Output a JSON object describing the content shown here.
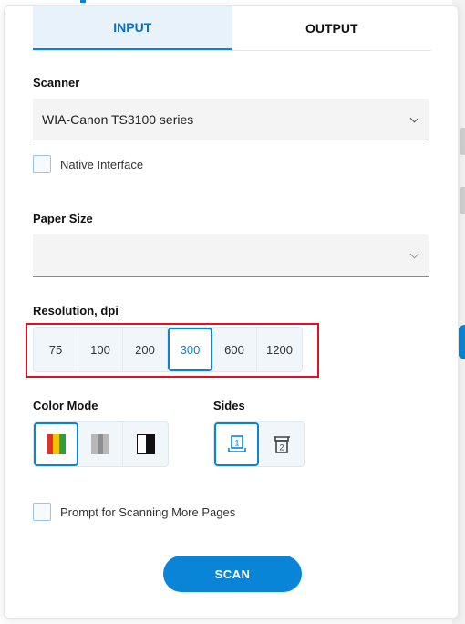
{
  "tabs": [
    {
      "label": "INPUT",
      "active": true
    },
    {
      "label": "OUTPUT",
      "active": false
    }
  ],
  "scanner": {
    "label": "Scanner",
    "value": "WIA-Canon TS3100 series",
    "native_interface_label": "Native Interface",
    "native_interface_checked": false
  },
  "paper_size": {
    "label": "Paper Size",
    "value": ""
  },
  "resolution": {
    "label": "Resolution, dpi",
    "options": [
      "75",
      "100",
      "200",
      "300",
      "600",
      "1200"
    ],
    "selected": "300"
  },
  "color_mode": {
    "label": "Color Mode",
    "options": [
      "color-icon",
      "grayscale-icon",
      "black-white-icon"
    ],
    "selected": "color-icon"
  },
  "sides": {
    "label": "Sides",
    "options": [
      "single-sided-icon",
      "double-sided-icon"
    ],
    "selected": "single-sided-icon"
  },
  "prompt_more_pages": {
    "label": "Prompt for Scanning More Pages",
    "checked": false
  },
  "scan_button": {
    "label": "SCAN"
  },
  "colors": {
    "accent": "#0a84d6",
    "highlight": "#e3101d"
  }
}
